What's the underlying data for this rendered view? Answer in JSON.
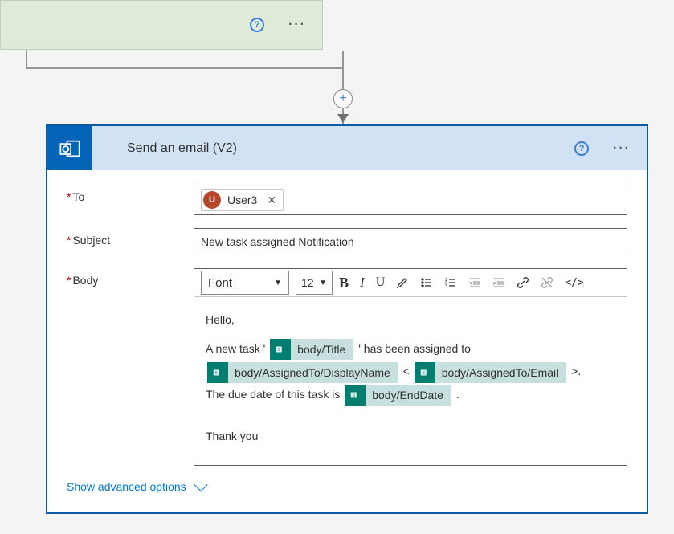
{
  "previous_action": {},
  "plus_label": "+",
  "action": {
    "title": "Send an email (V2)",
    "fields": {
      "to": {
        "label": "To",
        "user": {
          "initial": "U",
          "name": "User3"
        }
      },
      "subject": {
        "label": "Subject",
        "value": "New task assigned Notification"
      },
      "body": {
        "label": "Body"
      }
    },
    "rte": {
      "font_label": "Font",
      "font_size": "12",
      "bold": "B",
      "italic": "I",
      "underline": "U",
      "code": "</>"
    },
    "body_content": {
      "greeting": "Hello,",
      "line_a1": "A new task '",
      "token_title": "body/Title",
      "line_a2": "' has been assigned to",
      "token_assignee_name": "body/AssignedTo/DisplayName",
      "lt": "<",
      "token_assignee_email": "body/AssignedTo/Email",
      "gt": ">.",
      "line_c1": "The due date of this task is",
      "token_enddate": "body/EndDate",
      "dot": ".",
      "signoff": "Thank you"
    },
    "advanced_link": "Show advanced options"
  }
}
